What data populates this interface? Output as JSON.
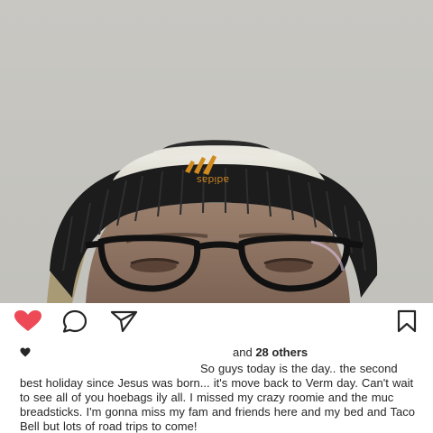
{
  "post": {
    "likes_prefix": "and ",
    "likes_count": "28 others",
    "caption": "So guys today is the day.. the second best holiday since Jesus was born... it's move back to Verm day. Can't wait to see all of you hoebags ily all. I missed my crazy roomie and the muc breadsticks. I'm gonna miss my fam and friends here and my bed and Taco Bell but lots of road trips to come!",
    "liked": true
  },
  "icons": {
    "like": "heart-icon",
    "comment": "comment-bubble-icon",
    "share": "paper-plane-icon",
    "save": "bookmark-icon",
    "likes_indicator": "small-heart-icon"
  },
  "colors": {
    "like_active": "#ed4956",
    "text": "#262626",
    "icon": "#262626"
  },
  "image": {
    "hat_logo_text": "adidas"
  }
}
